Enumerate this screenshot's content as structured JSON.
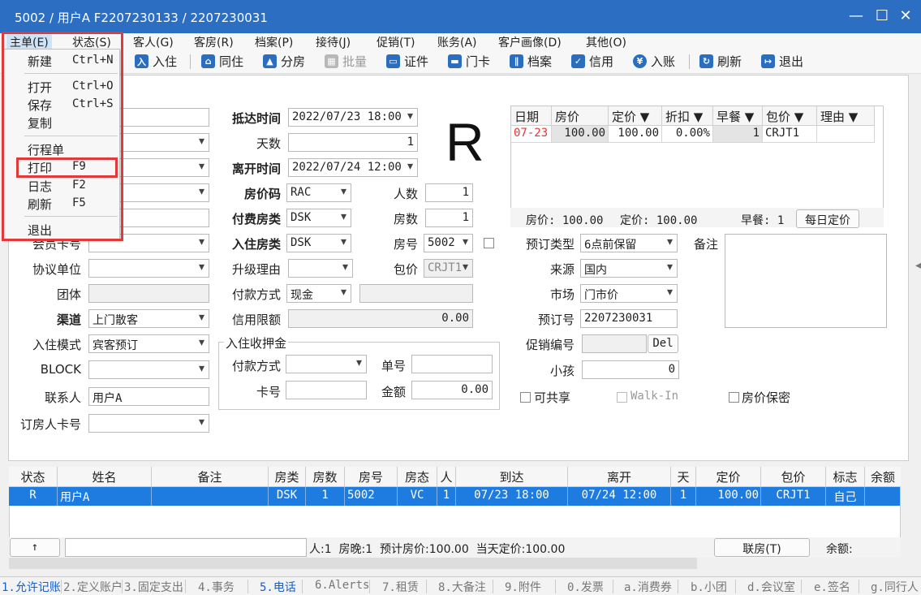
{
  "title": "5002 / 用户A F2207230133 / 2207230031",
  "menu": [
    "主单(E)",
    "状态(S)",
    "客人(G)",
    "客房(R)",
    "档案(P)",
    "接待(J)",
    "促销(T)",
    "账务(A)",
    "客户画像(D)",
    "其他(O)"
  ],
  "toolbar": [
    "入住",
    "同住",
    "分房",
    "批量",
    "证件",
    "门卡",
    "档案",
    "信用",
    "入账",
    "刷新",
    "退出"
  ],
  "dropdown": {
    "new": "新建",
    "new_key": "Ctrl+N",
    "open": "打开",
    "open_key": "Ctrl+O",
    "save": "保存",
    "save_key": "Ctrl+S",
    "copy": "复制",
    "itinerary": "行程单",
    "print": "打印",
    "print_key": "F9",
    "log": "日志",
    "log_key": "F2",
    "refresh": "刷新",
    "refresh_key": "F5",
    "exit": "退出"
  },
  "form": {
    "arrive_label": "抵达时间",
    "arrive": "2022/07/23 18:00",
    "days_label": "天数",
    "days": "1",
    "depart_label": "离开时间",
    "depart": "2022/07/24 12:00",
    "rate_code_label": "房价码",
    "rate_code": "RAC",
    "pay_room_label": "付费房类",
    "pay_room": "DSK",
    "checkin_room_label": "入住房类",
    "checkin_room": "DSK",
    "upgrade_label": "升级理由",
    "pay_method_label": "付款方式",
    "pay_method": "现金",
    "credit_label": "信用限额",
    "credit": "0.00",
    "persons_label": "人数",
    "persons": "1",
    "rooms_label": "房数",
    "rooms": "1",
    "room_no_label": "房号",
    "room_no": "5002",
    "package_label": "包价",
    "package": "CRJT1",
    "member_card_label": "会员卡号",
    "agreement_label": "协议单位",
    "group_label": "团体",
    "channel_label": "渠道",
    "channel": "上门散客",
    "checkin_mode_label": "入住模式",
    "checkin_mode": "宾客预订",
    "block_label": "BLOCK",
    "contact_label": "联系人",
    "contact": "用户A",
    "booker_card_label": "订房人卡号",
    "big_status": "R",
    "book_type_label": "预订类型",
    "book_type": "6点前保留",
    "source_label": "来源",
    "source": "国内",
    "market_label": "市场",
    "market": "门市价",
    "booking_no_label": "预订号",
    "booking_no": "2207230031",
    "promo_label": "促销编号",
    "del_btn": "Del",
    "child_label": "小孩",
    "child": "0",
    "remark_label": "备注",
    "shareable": "可共享",
    "walkin": "Walk-In",
    "rate_secret": "房价保密"
  },
  "deposit": {
    "legend": "入住收押金",
    "pay_label": "付款方式",
    "single_label": "单号",
    "card_label": "卡号",
    "amount_label": "金额",
    "amount": "0.00"
  },
  "rate_grid": {
    "headers": [
      "日期",
      "房价",
      "定价 ▼",
      "折扣 ▼",
      "早餐 ▼",
      "包价 ▼",
      "理由 ▼"
    ],
    "row": [
      "07-23",
      "100.00",
      "100.00",
      "0.00%",
      "1",
      "CRJT1",
      ""
    ],
    "summary_rate": "房价: 100.00",
    "summary_fixed": "定价: 100.00",
    "summary_bf": "早餐: 1",
    "daily_btn": "每日定价"
  },
  "guest_grid": {
    "headers": [
      "状态",
      "姓名",
      "备注",
      "房类",
      "房数",
      "房号",
      "房态",
      "人",
      "到达",
      "离开",
      "天",
      "定价",
      "包价",
      "标志",
      "余额"
    ],
    "row": [
      "R",
      "用户A",
      "",
      "DSK",
      "1",
      "5002",
      "VC",
      "1",
      "07/23 18:00",
      "07/24 12:00",
      "1",
      "100.00",
      "CRJT1",
      "自己",
      ""
    ]
  },
  "footer": {
    "up": "↑",
    "stats": "人:1  房晚:1  预计房价:100.00  当天定价:100.00",
    "join_btn": "联房(T)",
    "balance": "余额:"
  },
  "tabs": [
    "1.允许记账",
    "2.定义账户",
    "3.固定支出",
    "4.事务",
    "5.电话",
    "6.Alerts",
    "7.租赁",
    "8.大备注",
    "9.附件",
    "0.发票",
    "a.消费券",
    "b.小团",
    "d.会议室",
    "e.签名",
    "g.同行人"
  ]
}
